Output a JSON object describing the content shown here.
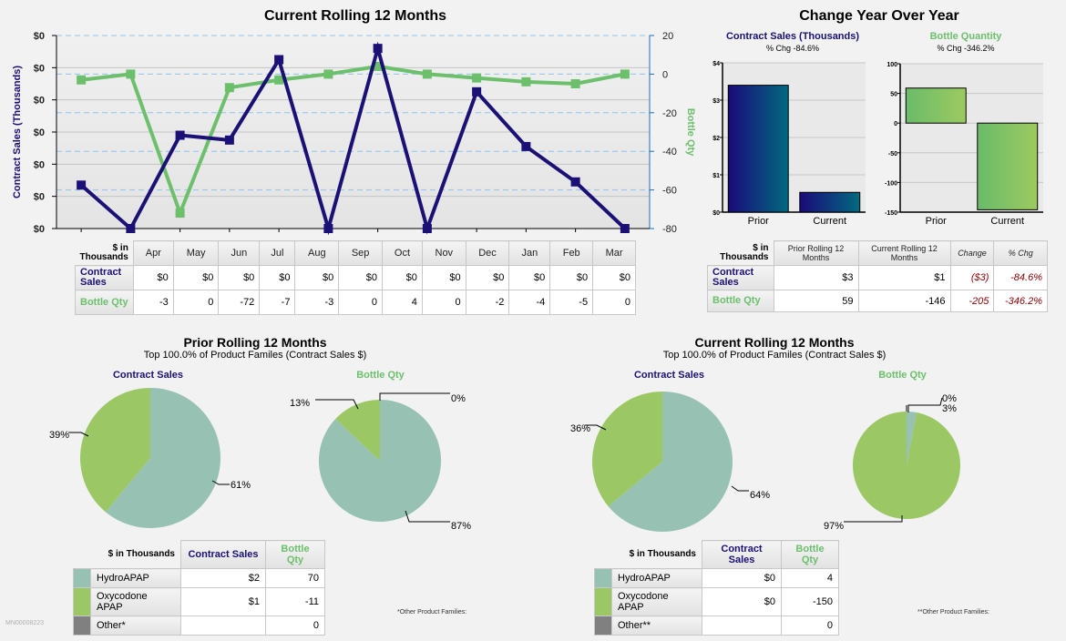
{
  "main_chart": {
    "title": "Current Rolling 12 Months",
    "left_axis_label": "Contract Sales (Thousands)",
    "right_axis_label": "Bottle Qty",
    "left_ticks": [
      "$0",
      "$0",
      "$0",
      "$0",
      "$0",
      "$0",
      "$0"
    ],
    "right_ticks": [
      "20",
      "0",
      "-20",
      "-40",
      "-60",
      "-80"
    ]
  },
  "chart_data": [
    {
      "type": "line",
      "title": "Current Rolling 12 Months",
      "categories": [
        "Apr",
        "May",
        "Jun",
        "Jul",
        "Aug",
        "Sep",
        "Oct",
        "Nov",
        "Dec",
        "Jan",
        "Feb",
        "Mar"
      ],
      "series": [
        {
          "name": "Contract Sales",
          "axis": "left",
          "color": "#1a1075",
          "values": [
            0.027,
            0,
            0.058,
            0.055,
            0.105,
            0,
            0.112,
            0,
            0.085,
            0.051,
            0.029,
            0
          ]
        },
        {
          "name": "Bottle Qty",
          "axis": "right",
          "color": "#6cc06c",
          "values": [
            -3,
            0,
            -72,
            -7,
            -3,
            0,
            4,
            0,
            -2,
            -4,
            -5,
            0
          ]
        }
      ],
      "ylabel": "Contract Sales (Thousands)",
      "ylim": [
        0,
        0.12
      ],
      "y2label": "Bottle Qty",
      "y2lim": [
        -80,
        20
      ],
      "grid": true
    },
    {
      "type": "bar",
      "title": "Contract Sales (Thousands)",
      "subtitle": "% Chg -84.6%",
      "categories": [
        "Prior",
        "Current"
      ],
      "values": [
        3.4,
        0.53
      ],
      "ylim": [
        0,
        4
      ],
      "ticks": [
        "$0",
        "$1",
        "$2",
        "$3",
        "$4"
      ]
    },
    {
      "type": "bar",
      "title": "Bottle Quantity",
      "subtitle": "% Chg -346.2%",
      "categories": [
        "Prior",
        "Current"
      ],
      "values": [
        59,
        -146
      ],
      "ylim": [
        -150,
        100
      ],
      "ticks": [
        "-150",
        "-100",
        "-50",
        "0",
        "50",
        "100"
      ]
    },
    {
      "type": "pie",
      "title": "Prior Rolling 12 Months - Contract Sales",
      "labels": [
        "HydroAPAP",
        "Oxycodone APAP"
      ],
      "values": [
        61,
        39
      ],
      "value_labels": [
        "61%",
        "39%"
      ]
    },
    {
      "type": "pie",
      "title": "Prior Rolling 12 Months - Bottle Qty",
      "labels": [
        "HydroAPAP",
        "Oxycodone APAP",
        "Other*"
      ],
      "values": [
        87,
        13,
        0
      ],
      "value_labels": [
        "87%",
        "13%",
        "0%"
      ]
    },
    {
      "type": "pie",
      "title": "Current Rolling 12 Months - Contract Sales",
      "labels": [
        "HydroAPAP",
        "Oxycodone APAP"
      ],
      "values": [
        64,
        36
      ],
      "value_labels": [
        "64%",
        "36%"
      ]
    },
    {
      "type": "pie",
      "title": "Current Rolling 12 Months - Bottle Qty",
      "labels": [
        "HydroAPAP",
        "Oxycodone APAP",
        "Other**"
      ],
      "values": [
        3,
        97,
        0
      ],
      "value_labels": [
        "3%",
        "97%",
        "0%"
      ]
    }
  ],
  "monthly_table": {
    "corner": "$ in Thousands",
    "months": [
      "Apr",
      "May",
      "Jun",
      "Jul",
      "Aug",
      "Sep",
      "Oct",
      "Nov",
      "Dec",
      "Jan",
      "Feb",
      "Mar"
    ],
    "rows": [
      {
        "label": "Contract Sales",
        "values": [
          "$0",
          "$0",
          "$0",
          "$0",
          "$0",
          "$0",
          "$0",
          "$0",
          "$0",
          "$0",
          "$0",
          "$0"
        ]
      },
      {
        "label": "Bottle Qty",
        "values": [
          "-3",
          "0",
          "-72",
          "-7",
          "-3",
          "0",
          "4",
          "0",
          "-2",
          "-4",
          "-5",
          "0"
        ]
      }
    ]
  },
  "yoy": {
    "title": "Change Year Over Year",
    "left_title": "Contract Sales (Thousands)",
    "left_sub": "% Chg -84.6%",
    "right_title": "Bottle Quantity",
    "right_sub": "% Chg -346.2%",
    "x_labels": [
      "Prior",
      "Current"
    ],
    "table": {
      "corner": "$ in Thousands",
      "headers": [
        "Prior Rolling 12 Months",
        "Current Rolling 12 Months",
        "Change",
        "% Chg"
      ],
      "rows": [
        {
          "label": "Contract Sales",
          "values": [
            "$3",
            "$1",
            "($3)",
            "-84.6%"
          ]
        },
        {
          "label": "Bottle Qty",
          "values": [
            "59",
            "-146",
            "-205",
            "-346.2%"
          ]
        }
      ]
    }
  },
  "prior_section": {
    "title": "Prior Rolling 12 Months",
    "subtitle": "Top 100.0% of Product Familes (Contract Sales $)",
    "pie_left_title": "Contract Sales",
    "pie_right_title": "Bottle Qty",
    "legend": {
      "corner": "$ in Thousands",
      "col1": "Contract Sales",
      "col2": "Bottle Qty",
      "rows": [
        {
          "name": "HydroAPAP",
          "color": "#97c2b3",
          "sales": "$2",
          "qty": "70"
        },
        {
          "name": "Oxycodone APAP",
          "color": "#9bc865",
          "sales": "$1",
          "qty": "-11"
        },
        {
          "name": "Other*",
          "color": "#808080",
          "sales": "",
          "qty": "0"
        }
      ]
    },
    "footnote": "*Other Product Families:"
  },
  "current_section": {
    "title": "Current Rolling 12 Months",
    "subtitle": "Top 100.0% of Product Familes (Contract Sales $)",
    "pie_left_title": "Contract Sales",
    "pie_right_title": "Bottle Qty",
    "legend": {
      "corner": "$ in Thousands",
      "col1": "Contract Sales",
      "col2": "Bottle Qty",
      "rows": [
        {
          "name": "HydroAPAP",
          "color": "#97c2b3",
          "sales": "$0",
          "qty": "4"
        },
        {
          "name": "Oxycodone APAP",
          "color": "#9bc865",
          "sales": "$0",
          "qty": "-150"
        },
        {
          "name": "Other**",
          "color": "#808080",
          "sales": "",
          "qty": "0"
        }
      ]
    },
    "footnote": "**Other Product Families:"
  },
  "report_id": "MN00008223",
  "colors": {
    "navy": "#1a1075",
    "green": "#6cc06c",
    "teal": "#97c2b3",
    "lime": "#9bc865",
    "gray": "#808080"
  }
}
